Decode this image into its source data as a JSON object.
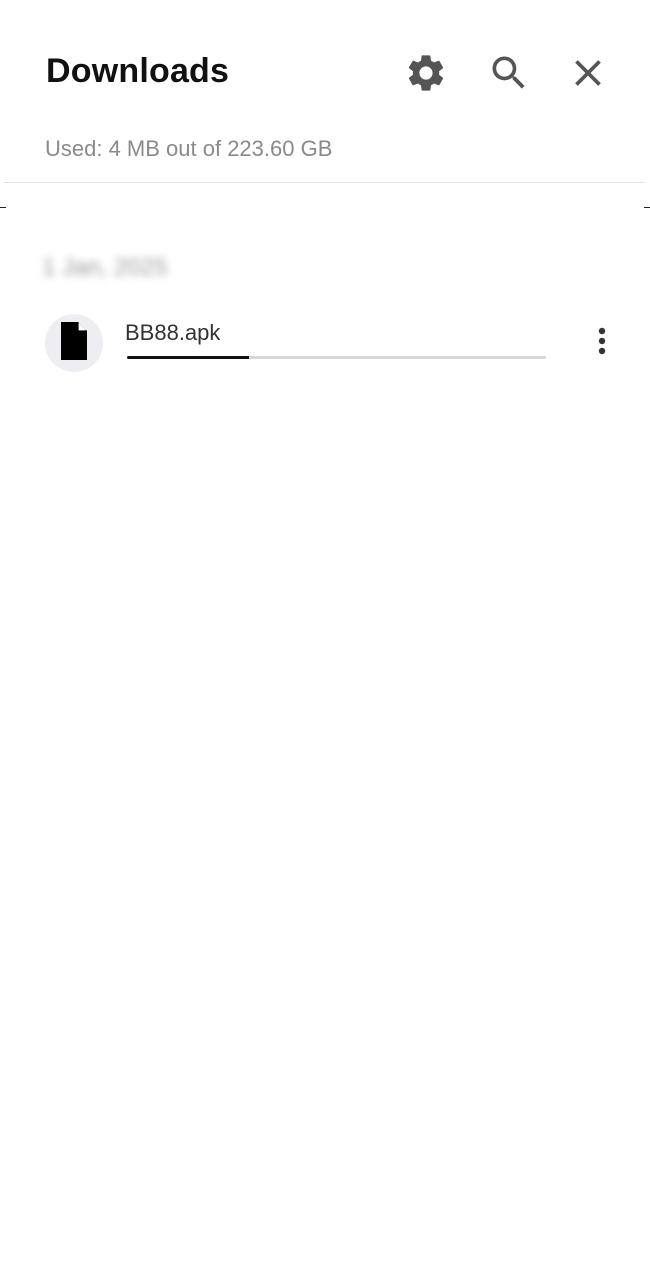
{
  "header": {
    "title": "Downloads",
    "icons": [
      "gear-icon",
      "search-icon",
      "close-icon"
    ]
  },
  "storage": {
    "text": "Used: 4 MB out of 223.60 GB"
  },
  "list": {
    "date_header": "1 Jan, 2025",
    "items": [
      {
        "name": "BB88.apk",
        "icon": "file-icon",
        "progress": 0.29
      }
    ]
  },
  "colors": {
    "background": "#ffffff",
    "title": "#111111",
    "secondary_text": "#8a8a8a",
    "icon": "#555555",
    "progress_fill": "#111111",
    "progress_track": "#d6d6d6",
    "file_icon_bg": "#eeeef2"
  }
}
